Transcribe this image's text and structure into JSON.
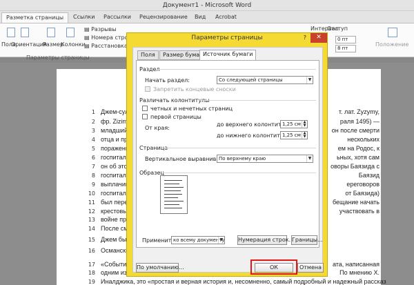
{
  "window": {
    "title": "Документ1 - Microsoft Word"
  },
  "tabs": [
    "Разметка страницы",
    "Ссылки",
    "Рассылки",
    "Рецензирование",
    "Вид",
    "Acrobat"
  ],
  "ribbon": {
    "fields": "Поля",
    "orientation": "Ориентация",
    "size": "Размер",
    "columns": "Колонки",
    "breaks": "Разрывы",
    "line_numbers": "Номера строк",
    "hyphenation": "Расстановка п",
    "indent": "Отступ",
    "interval": "Интервал",
    "before_value": "0 пт",
    "after_value": "8 пт",
    "position": "Положение",
    "group_label": "Параметры страницы"
  },
  "document": {
    "lines": [
      {
        "n": "1",
        "left": "Джем-сул",
        "right": "т. лат. Zyzymy,"
      },
      {
        "n": "2",
        "left": "фр. Zizim,",
        "right": "раля 1495) —"
      },
      {
        "n": "3",
        "left": "младший",
        "right": "он после смерти"
      },
      {
        "n": "4",
        "left": "отца и пре",
        "right": "нескольких"
      },
      {
        "n": "5",
        "left": "поражени",
        "right": "ем на Родос, к"
      },
      {
        "n": "6",
        "left": "госпиталь",
        "right": "ьных, хотя сам"
      },
      {
        "n": "7",
        "left": "он об это",
        "right": "оворы Баязида с"
      },
      {
        "n": "8",
        "left": "госпиталь",
        "right": "Баязид"
      },
      {
        "n": "9",
        "left": "выплачив",
        "right": "ереговоров"
      },
      {
        "n": "10",
        "left": "госпиталь",
        "right": "от Баязида)"
      },
      {
        "n": "11",
        "left": "был перед",
        "right": "бещание начать"
      },
      {
        "n": "12",
        "left": "крестовы",
        "right": "участвовать в"
      },
      {
        "n": "13",
        "left": "войне про",
        "right": ""
      },
      {
        "n": "14",
        "left": "После сме",
        "right": ""
      },
      {
        "n": "15",
        "left": "Джем был",
        "right": ""
      },
      {
        "n": "16",
        "left": "Османски",
        "right": ""
      },
      {
        "n": "17",
        "left": "«Событи",
        "right": "ата, написанная"
      },
      {
        "n": "18",
        "left": "одним из",
        "right": "По мнению Х."
      },
      {
        "n": "19",
        "left": "Иналджика, это «простая и верная история и, несомненно, самый подробный и надежный рассказ",
        "right": ""
      }
    ]
  },
  "dialog": {
    "title": "Параметры страницы",
    "close": "✕",
    "help": "?",
    "tabs": [
      "Поля",
      "Размер бумаги",
      "Источник бумаги"
    ],
    "section_label": "Раздел",
    "start_label": "Начать раздел:",
    "start_value": "Со следующей страницы",
    "suppress_endnotes": "Запретить концевые сноски",
    "headers_label": "Различать колонтитулы",
    "odd_even": "четных и нечетных страниц",
    "first_page": "первой страницы",
    "from_edge": "От края:",
    "to_header": "до верхнего колонтитула:",
    "header_value": "1,25 см",
    "to_footer": "до нижнего колонтитула:",
    "footer_value": "1,25 см",
    "page_label": "Страница",
    "valign_label": "Вертикальное выравнивание:",
    "valign_value": "По верхнему краю",
    "sample_label": "Образец",
    "apply_label": "Применить:",
    "apply_value": "ко всему документу",
    "line_numbers_btn": "Нумерация строк...",
    "borders_btn": "Границы...",
    "default_btn": "По умолчанию...",
    "ok_btn": "ОК",
    "cancel_btn": "Отмена",
    "highlight_color": "#e01818"
  }
}
